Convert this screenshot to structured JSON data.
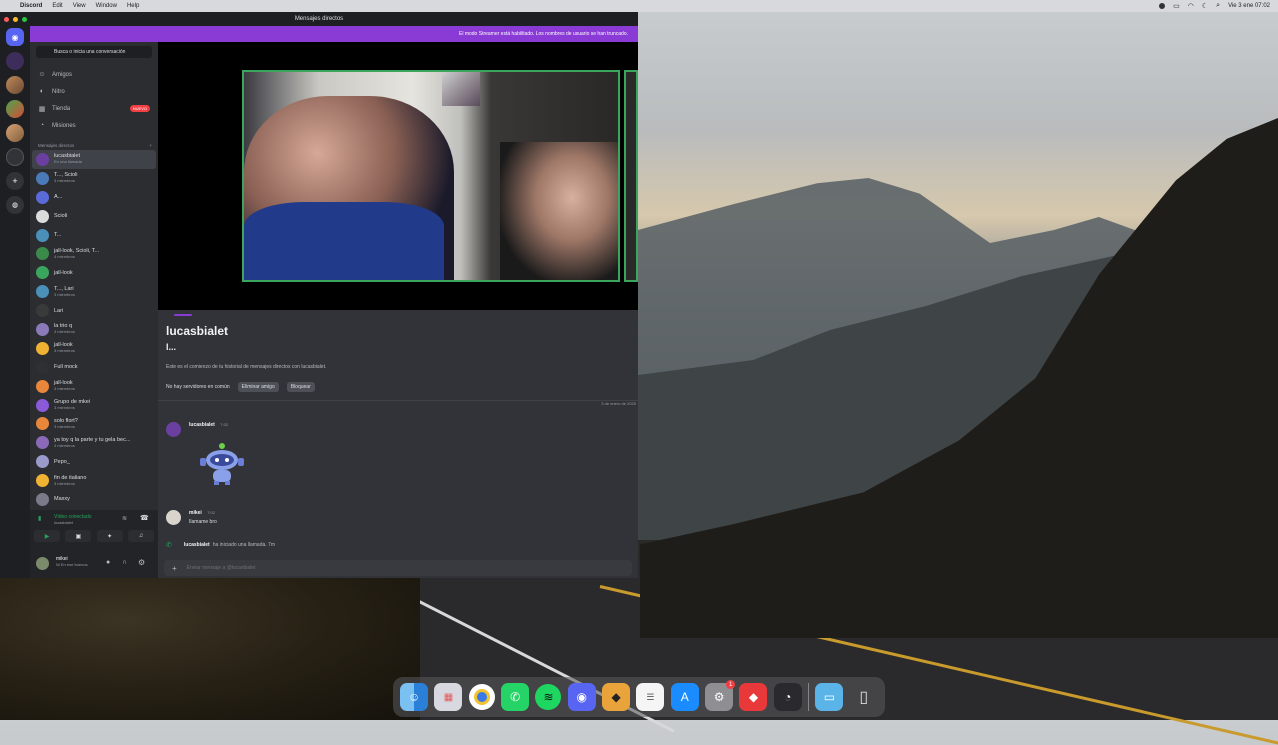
{
  "menubar": {
    "app_name": "Discord",
    "items": [
      "Edit",
      "View",
      "Window",
      "Help"
    ],
    "clock": "Vie 3 ene  07:02"
  },
  "window": {
    "title": "Mensajes directos",
    "banner": "El modo Streamer está habilitado. Los nombres de usuario se han truncado."
  },
  "sidebar": {
    "search_placeholder": "Busca o inicia una conversación",
    "nav": [
      {
        "label": "Amigos",
        "icon": "friends-icon"
      },
      {
        "label": "Nitro",
        "icon": "nitro-icon"
      },
      {
        "label": "Tienda",
        "icon": "shop-icon",
        "badge": "NUEVO"
      },
      {
        "label": "Misiones",
        "icon": "quests-icon"
      }
    ],
    "dm_header": "Mensajes directos",
    "dm_header_add": "+",
    "dms": [
      {
        "name": "lucasbialet",
        "sub": "En una llamada",
        "color": "#6b3fa0",
        "active": true
      },
      {
        "name": "T..., Scioli",
        "sub": "3 miembros",
        "color": "#4a7ab8"
      },
      {
        "name": "A...",
        "sub": "",
        "color": "#5a6ad8"
      },
      {
        "name": "Scioli",
        "sub": "",
        "color": "#dcdcdc"
      },
      {
        "name": "T...",
        "sub": "",
        "color": "#4a90b8"
      },
      {
        "name": "jall-look, Scioli, T...",
        "sub": "4 miembros",
        "color": "#3a8a4a"
      },
      {
        "name": "jall-look",
        "sub": "",
        "color": "#3aa55d"
      },
      {
        "name": "T..., Lari",
        "sub": "3 miembros",
        "color": "#4a90b8"
      },
      {
        "name": "Lari",
        "sub": "",
        "color": "#3a3a3a"
      },
      {
        "name": "la trio q",
        "sub": "3 miembros",
        "color": "#8a7ab8"
      },
      {
        "name": "jall-look",
        "sub": "3 miembros",
        "color": "#f0b232"
      },
      {
        "name": "Full mock",
        "sub": "",
        "color": "#2e3035"
      },
      {
        "name": "jall-look",
        "sub": "3 miembros",
        "color": "#e8873a"
      },
      {
        "name": "Grupo de mkei",
        "sub": "3 miembros",
        "color": "#8a5ad8"
      },
      {
        "name": "solo flort?",
        "sub": "3 miembros",
        "color": "#e8873a"
      },
      {
        "name": "ya toy q la parte y tu gela bec...",
        "sub": "4 miembros",
        "color": "#8a6ab8"
      },
      {
        "name": "Pepo_",
        "sub": "",
        "color": "#9a9acb"
      },
      {
        "name": "fin de italiano",
        "sub": "3 miembros",
        "color": "#f0b232"
      },
      {
        "name": "Maxxy",
        "sub": "",
        "color": "#7a7a8a"
      }
    ]
  },
  "voice_panel": {
    "status": "Vídeo conectado",
    "channel": "lucasbialet"
  },
  "user_panel": {
    "name": "mikei",
    "status": "Ni En ese buenos"
  },
  "profile": {
    "name": "lucasbialet",
    "subname": "l...",
    "description": "Este es el comienzo de tu historial de mensajes directos con lucasbialet.",
    "actions": [
      "No hay servidores en común",
      "Eliminar amigo",
      "Bloquear"
    ],
    "date_divider": "3 de enero de 2025"
  },
  "messages": [
    {
      "author": "lucasbialet",
      "time": "7:02",
      "text": ""
    },
    {
      "author": "mikei",
      "time": "7:02",
      "text": "Ilamame bro"
    }
  ],
  "call_message": {
    "author": "lucasbialet",
    "text": "ha iniciado una llamada.  7m"
  },
  "composer": {
    "placeholder": "Enviar mensaje a @lucasbialet"
  },
  "dock": {
    "badge_settings": "1"
  }
}
